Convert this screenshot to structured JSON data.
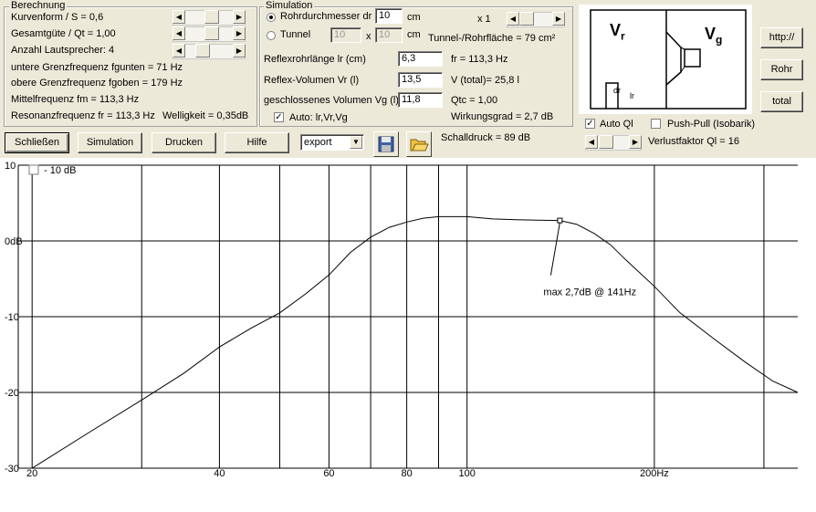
{
  "berechnung": {
    "title": "Berechnung",
    "kurvenform": "Kurvenform / S = 0,6",
    "guete": "Gesamtgüte / Qt = 1,00",
    "lautsprecher": "Anzahl Lautsprecher: 4",
    "fgunten": "untere Grenzfrequenz fgunten = 71 Hz",
    "fgoben": "obere Grenzfrequenz fgoben = 179 Hz",
    "fm": "Mittelfrequenz fm = 113,3 Hz",
    "fr": "Resonanzfrequenz fr = 113,3 Hz",
    "welligkeit": "Welligkeit = 0,35dB"
  },
  "simulation": {
    "title": "Simulation",
    "rohr_label": "Rohrdurchmesser dr",
    "rohr_value": "10",
    "rohr_unit": "cm",
    "multiplier": "x 1",
    "tunnel_label": "Tunnel",
    "tunnel_a": "10",
    "tunnel_x": "x",
    "tunnel_b": "10",
    "tunnel_unit": "cm",
    "flaeche": "Tunnel-/Rohrfläche = 79 cm²",
    "reflexlaenge_label": "Reflexrohrlänge lr (cm)",
    "reflexlaenge_value": "6,3",
    "fr_out": "fr = 113,3 Hz",
    "reflexvol_label": "Reflex-Volumen Vr (l)",
    "reflexvol_value": "13,5",
    "vtotal": "V (total)= 25,8 l",
    "geschl_label": "geschlossenes Volumen Vg (l)",
    "geschl_value": "11,8",
    "qtc": "Qtc = 1,00",
    "auto_label": "Auto: lr,Vr,Vg",
    "wirkungsgrad": "Wirkungsgrad = 2,7 dB"
  },
  "diagram": {
    "vr": "V",
    "vr_sub": "r",
    "vg": "V",
    "vg_sub": "g",
    "dr": "dr",
    "lr": "lr"
  },
  "right_buttons": {
    "http": "http://",
    "rohr": "Rohr",
    "total": "total"
  },
  "options": {
    "auto_ql": "Auto Ql",
    "push_pull": "Push-Pull (Isobarik)",
    "verlustfaktor": "Verlustfaktor Ql = 16"
  },
  "toolbar": {
    "schliessen": "Schließen",
    "simulation": "Simulation",
    "drucken": "Drucken",
    "hilfe": "Hilfe",
    "export_value": "export",
    "schalldruck": "Schalldruck = 89 dB"
  },
  "chart_data": {
    "type": "line",
    "x_scale": "log",
    "xlim": [
      19,
      340
    ],
    "ylim": [
      -30,
      10
    ],
    "grid": true,
    "x_ticks": [
      {
        "value": 20,
        "label": "20"
      },
      {
        "value": 40,
        "label": "40"
      },
      {
        "value": 60,
        "label": "60"
      },
      {
        "value": 80,
        "label": "80"
      },
      {
        "value": 100,
        "label": "100"
      },
      {
        "value": 200,
        "label": "200Hz"
      }
    ],
    "x_gridlines": [
      20,
      30,
      40,
      50,
      60,
      70,
      80,
      90,
      100,
      200,
      300
    ],
    "y_ticks": [
      {
        "value": 10,
        "label": "10"
      },
      {
        "value": 0,
        "label": "0dB"
      },
      {
        "value": -10,
        "label": "-10"
      },
      {
        "value": -20,
        "label": "-20"
      },
      {
        "value": -30,
        "label": "-30"
      }
    ],
    "checkbox_label": "- 10 dB",
    "annotation": {
      "x": 141,
      "y": 2.7,
      "text": "max 2,7dB @ 141Hz"
    },
    "series": [
      {
        "x": [
          20,
          25,
          30,
          35,
          40,
          45,
          50,
          55,
          60,
          65,
          70,
          75,
          80,
          85,
          90,
          100,
          110,
          120,
          130,
          141,
          150,
          160,
          170,
          180,
          200,
          220,
          250,
          280,
          310,
          340
        ],
        "y": [
          -30,
          -25,
          -21,
          -17.5,
          -14,
          -11.5,
          -9.5,
          -7,
          -4.5,
          -1.5,
          0.5,
          1.8,
          2.5,
          3,
          3.2,
          3.2,
          2.9,
          2.8,
          2.75,
          2.7,
          2.2,
          1,
          -0.5,
          -2.5,
          -6,
          -9.5,
          -13,
          -16,
          -18.5,
          -20
        ]
      }
    ]
  }
}
